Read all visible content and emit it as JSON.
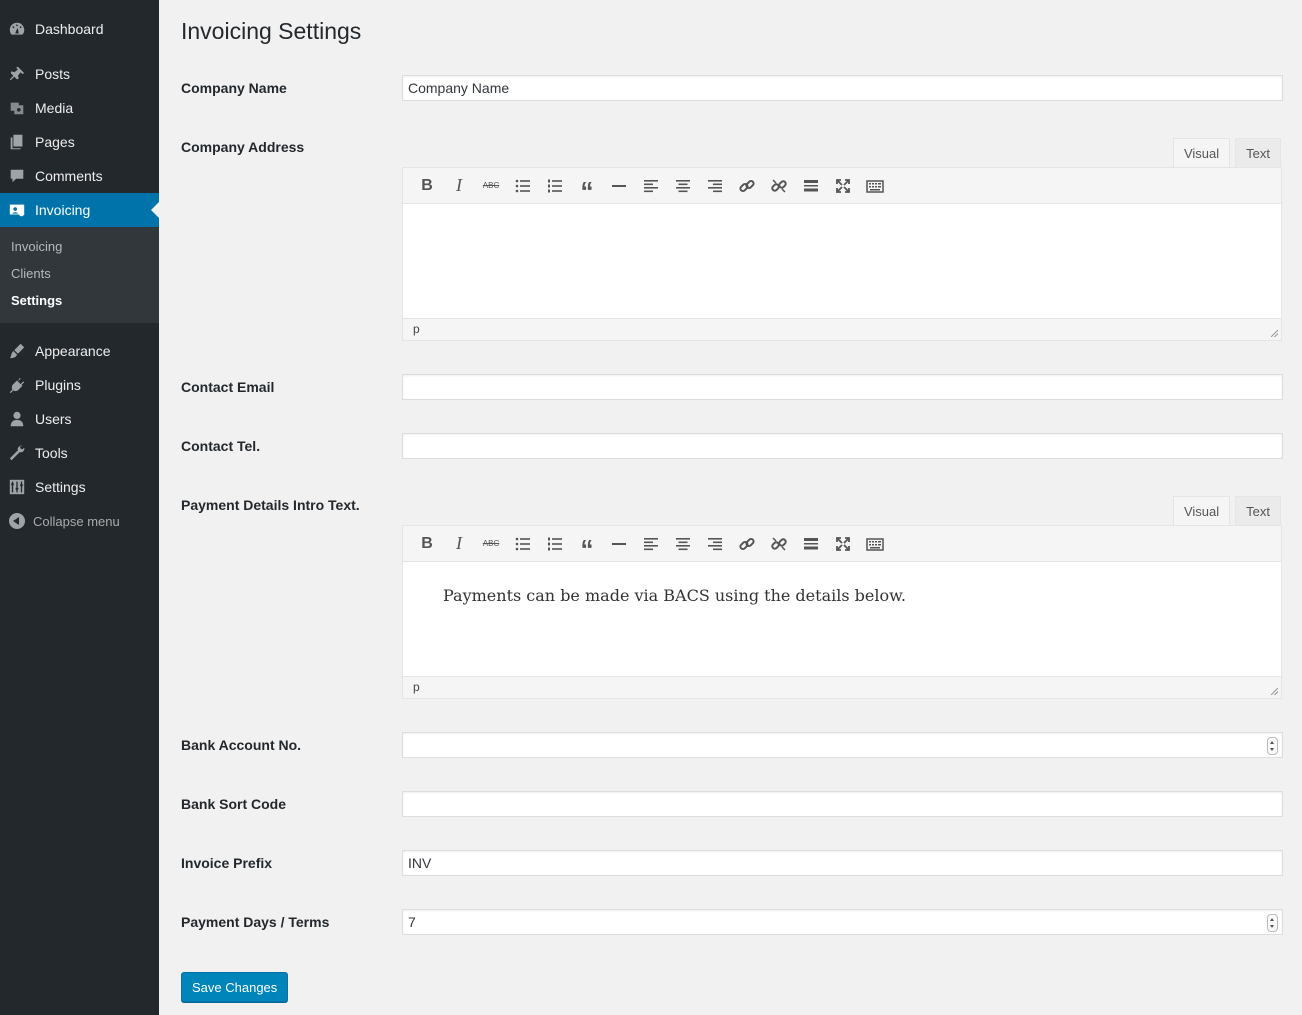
{
  "sidebar": {
    "items": [
      {
        "label": "Dashboard",
        "icon": "dashboard-icon"
      },
      {
        "label": "Posts",
        "icon": "pin-icon"
      },
      {
        "label": "Media",
        "icon": "media-icon"
      },
      {
        "label": "Pages",
        "icon": "pages-icon"
      },
      {
        "label": "Comments",
        "icon": "comment-icon"
      },
      {
        "label": "Invoicing",
        "icon": "invoice-icon",
        "active": true
      },
      {
        "label": "Appearance",
        "icon": "brush-icon"
      },
      {
        "label": "Plugins",
        "icon": "plugin-icon"
      },
      {
        "label": "Users",
        "icon": "user-icon"
      },
      {
        "label": "Tools",
        "icon": "wrench-icon"
      },
      {
        "label": "Settings",
        "icon": "settings-icon"
      }
    ],
    "submenu": [
      {
        "label": "Invoicing"
      },
      {
        "label": "Clients"
      },
      {
        "label": "Settings",
        "current": true
      }
    ],
    "collapse_label": "Collapse menu"
  },
  "page": {
    "title": "Invoicing Settings"
  },
  "fields": {
    "company_name": {
      "label": "Company Name",
      "value": "Company Name"
    },
    "company_address": {
      "label": "Company Address",
      "content": "",
      "path": "p"
    },
    "contact_email": {
      "label": "Contact Email",
      "value": ""
    },
    "contact_tel": {
      "label": "Contact Tel.",
      "value": ""
    },
    "payment_intro": {
      "label": "Payment Details Intro Text.",
      "content": "Payments can be made via BACS using the details below.",
      "path": "p"
    },
    "bank_account": {
      "label": "Bank Account No.",
      "value": ""
    },
    "bank_sort_code": {
      "label": "Bank Sort Code",
      "value": ""
    },
    "invoice_prefix": {
      "label": "Invoice Prefix",
      "value": "INV"
    },
    "payment_days": {
      "label": "Payment Days / Terms",
      "value": "7"
    }
  },
  "editor": {
    "tab_visual": "Visual",
    "tab_text": "Text"
  },
  "actions": {
    "save_label": "Save Changes"
  },
  "colors": {
    "sidebar_bg": "#23282d",
    "active_blue": "#0073aa",
    "button_blue": "#0085ba"
  }
}
